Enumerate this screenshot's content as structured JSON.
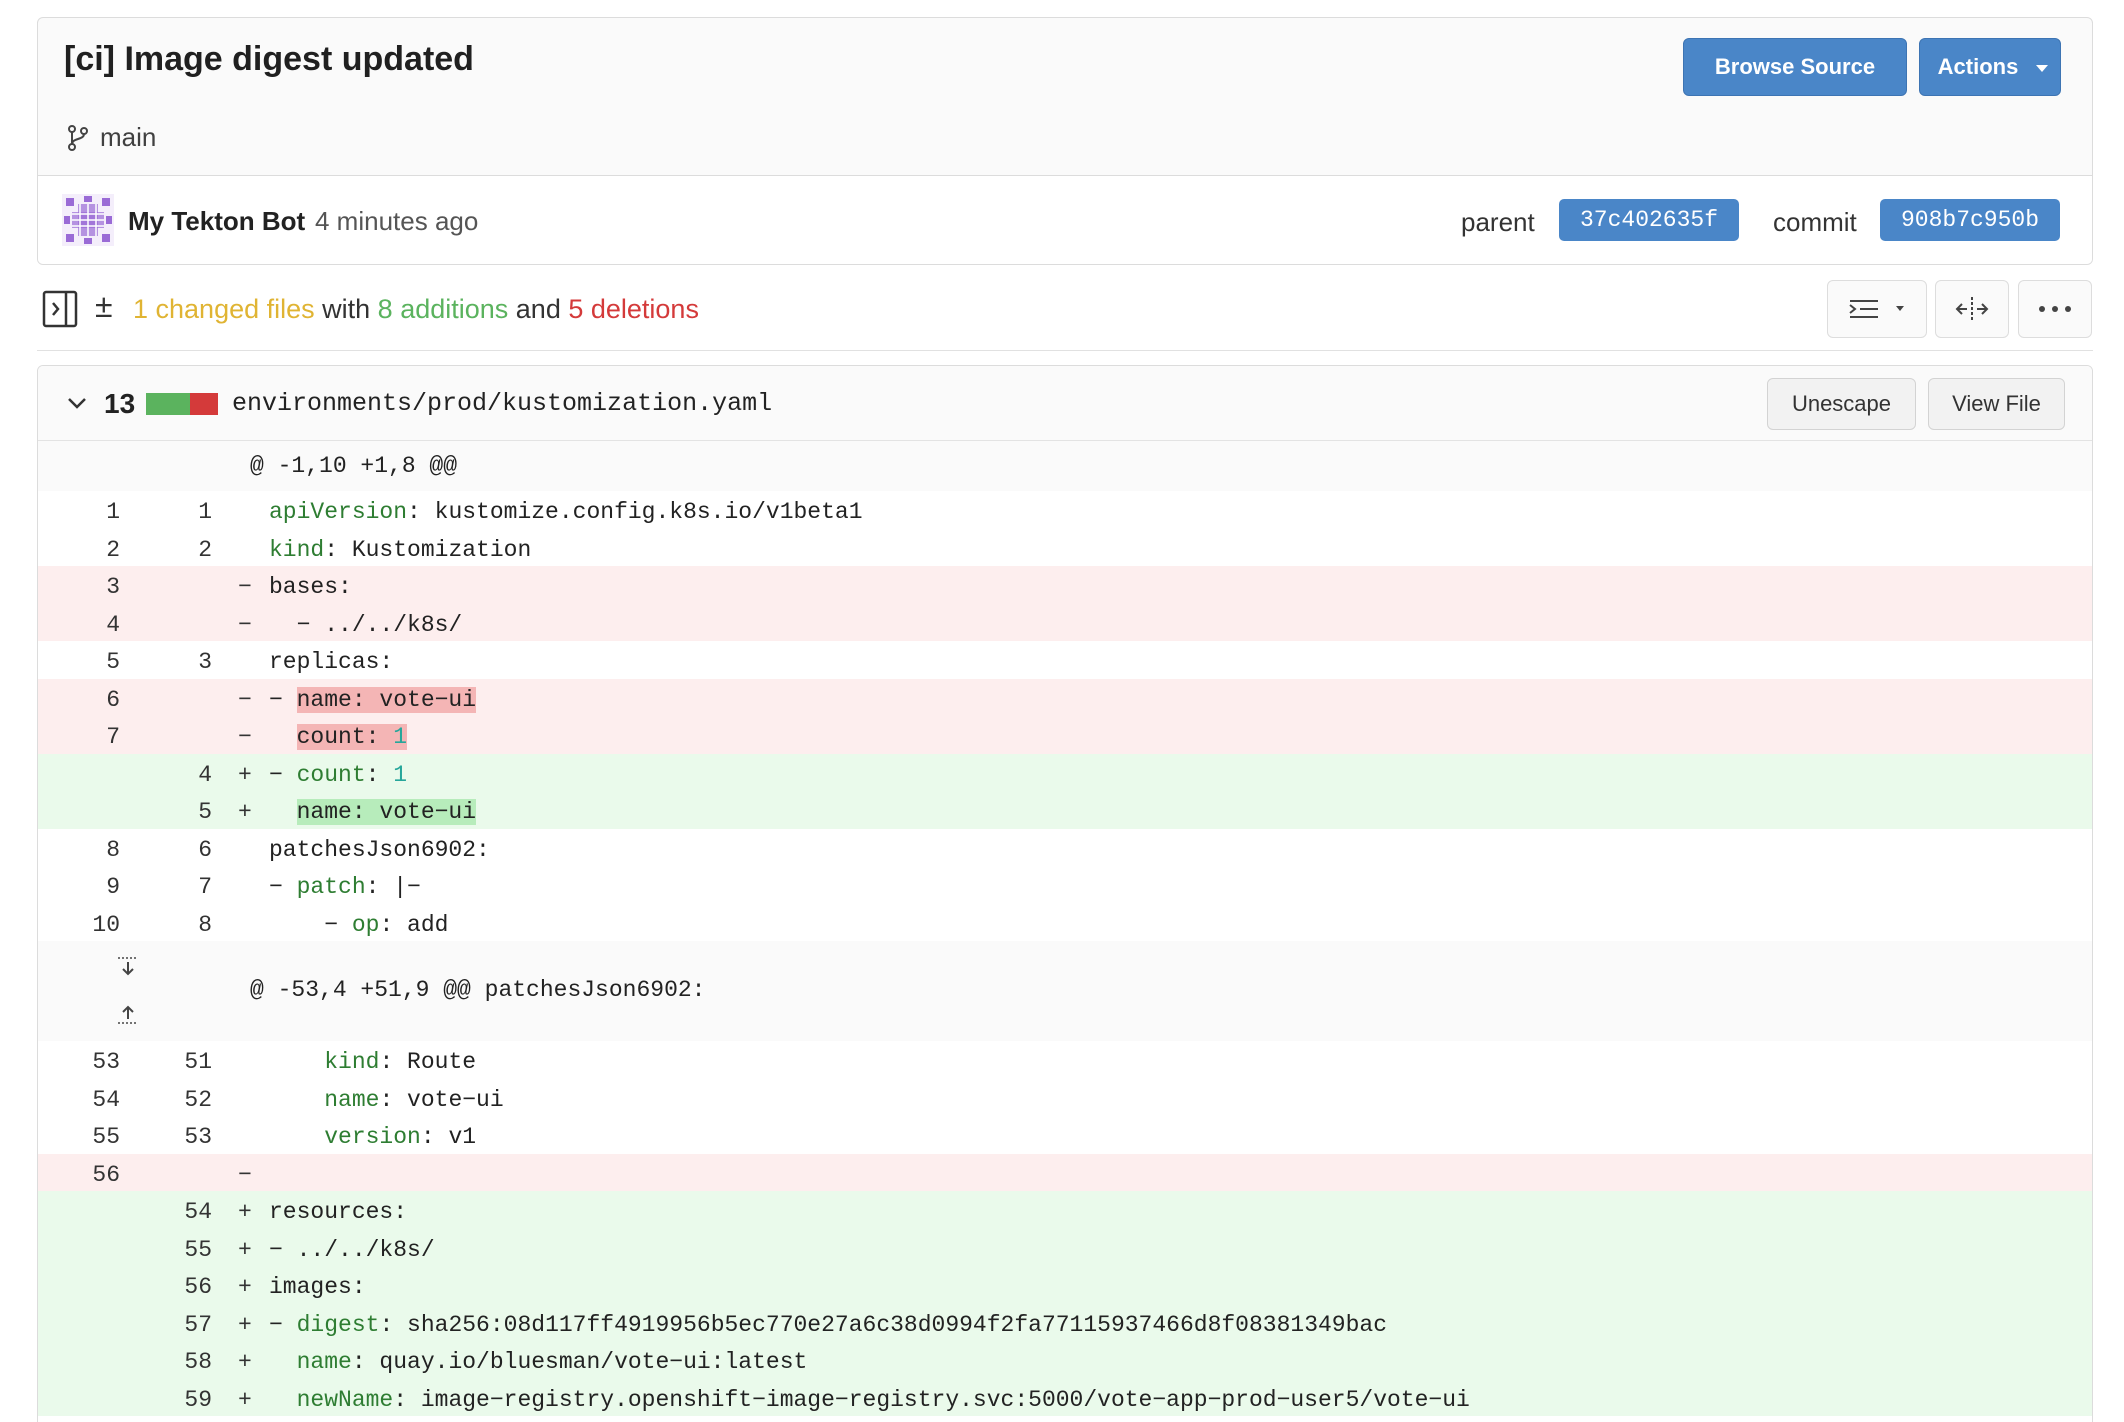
{
  "commit": {
    "title": "[ci] Image digest updated",
    "branch": "main",
    "author": "My Tekton Bot",
    "time": "4 minutes ago",
    "parent_label": "parent",
    "parent_hash": "37c402635f",
    "commit_label": "commit",
    "commit_hash": "908b7c950b"
  },
  "buttons": {
    "browse_source": "Browse Source",
    "actions": "Actions",
    "unescape": "Unescape",
    "view_file": "View File"
  },
  "summary": {
    "changed": "1 changed files",
    "with": " with ",
    "additions": "8 additions",
    "and": " and ",
    "deletions": "5 deletions"
  },
  "file": {
    "count": "13",
    "path": "environments/prod/kustomization.yaml"
  },
  "hunks": {
    "first": "@ -1,10 +1,8 @@",
    "second": "@ -53,4 +51,9 @@ patchesJson6902:"
  },
  "diff": [
    {
      "type": "ctx",
      "old": "1",
      "new": "1",
      "sign": "",
      "parts": [
        {
          "t": "apiVersion",
          "c": "k"
        },
        {
          "t": ": kustomize.config.k8s.io/v1beta1"
        }
      ]
    },
    {
      "type": "ctx",
      "old": "2",
      "new": "2",
      "sign": "",
      "parts": [
        {
          "t": "kind",
          "c": "k"
        },
        {
          "t": ": Kustomization"
        }
      ]
    },
    {
      "type": "del",
      "old": "3",
      "new": "",
      "sign": "−",
      "parts": [
        {
          "t": "bases:"
        }
      ]
    },
    {
      "type": "del",
      "old": "4",
      "new": "",
      "sign": "−",
      "parts": [
        {
          "t": "  − ../../k8s/"
        }
      ]
    },
    {
      "type": "ctx",
      "old": "5",
      "new": "3",
      "sign": "",
      "parts": [
        {
          "t": "replicas:"
        }
      ]
    },
    {
      "type": "del",
      "old": "6",
      "new": "",
      "sign": "−",
      "parts": [
        {
          "t": "− "
        },
        {
          "t": "name: vote−ui",
          "c": "hl-del"
        }
      ]
    },
    {
      "type": "del",
      "old": "7",
      "new": "",
      "sign": "−",
      "parts": [
        {
          "t": "  "
        },
        {
          "t": "count: ",
          "c": "hl-del"
        },
        {
          "t": "1",
          "c": "hl-del n"
        }
      ]
    },
    {
      "type": "add",
      "old": "",
      "new": "4",
      "sign": "+",
      "parts": [
        {
          "t": "− "
        },
        {
          "t": "count",
          "c": "k"
        },
        {
          "t": ": "
        },
        {
          "t": "1",
          "c": "n"
        }
      ]
    },
    {
      "type": "add",
      "old": "",
      "new": "5",
      "sign": "+",
      "parts": [
        {
          "t": "  "
        },
        {
          "t": "name: vote−ui",
          "c": "hl-add"
        }
      ]
    },
    {
      "type": "ctx",
      "old": "8",
      "new": "6",
      "sign": "",
      "parts": [
        {
          "t": "patchesJson6902:"
        }
      ]
    },
    {
      "type": "ctx",
      "old": "9",
      "new": "7",
      "sign": "",
      "parts": [
        {
          "t": "− "
        },
        {
          "t": "patch",
          "c": "k"
        },
        {
          "t": ": |−"
        }
      ]
    },
    {
      "type": "ctx",
      "old": "10",
      "new": "8",
      "sign": "",
      "parts": [
        {
          "t": "    − "
        },
        {
          "t": "op",
          "c": "k"
        },
        {
          "t": ": add"
        }
      ]
    }
  ],
  "diff2": [
    {
      "type": "ctx",
      "old": "53",
      "new": "51",
      "sign": "",
      "parts": [
        {
          "t": "    "
        },
        {
          "t": "kind",
          "c": "k"
        },
        {
          "t": ": Route"
        }
      ]
    },
    {
      "type": "ctx",
      "old": "54",
      "new": "52",
      "sign": "",
      "parts": [
        {
          "t": "    "
        },
        {
          "t": "name",
          "c": "k"
        },
        {
          "t": ": vote−ui"
        }
      ]
    },
    {
      "type": "ctx",
      "old": "55",
      "new": "53",
      "sign": "",
      "parts": [
        {
          "t": "    "
        },
        {
          "t": "version",
          "c": "k"
        },
        {
          "t": ": v1"
        }
      ]
    },
    {
      "type": "del",
      "old": "56",
      "new": "",
      "sign": "−",
      "parts": []
    },
    {
      "type": "add",
      "old": "",
      "new": "54",
      "sign": "+",
      "parts": [
        {
          "t": "resources:"
        }
      ]
    },
    {
      "type": "add",
      "old": "",
      "new": "55",
      "sign": "+",
      "parts": [
        {
          "t": "− ../../k8s/"
        }
      ]
    },
    {
      "type": "add",
      "old": "",
      "new": "56",
      "sign": "+",
      "parts": [
        {
          "t": "images:"
        }
      ]
    },
    {
      "type": "add",
      "old": "",
      "new": "57",
      "sign": "+",
      "parts": [
        {
          "t": "− "
        },
        {
          "t": "digest",
          "c": "k"
        },
        {
          "t": ": sha256:08d117ff4919956b5ec770e27a6c38d0994f2fa77115937466d8f08381349bac"
        }
      ]
    },
    {
      "type": "add",
      "old": "",
      "new": "58",
      "sign": "+",
      "parts": [
        {
          "t": "  "
        },
        {
          "t": "name",
          "c": "k"
        },
        {
          "t": ": quay.io/bluesman/vote−ui:latest"
        }
      ]
    },
    {
      "type": "add",
      "old": "",
      "new": "59",
      "sign": "+",
      "parts": [
        {
          "t": "  "
        },
        {
          "t": "newName",
          "c": "k"
        },
        {
          "t": ": image−registry.openshift−image−registry.svc:5000/vote−app−prod−user5/vote−ui"
        }
      ]
    }
  ],
  "icons": {
    "branch": "git-branch-icon",
    "sidebar": "sidebar-toggle-icon",
    "wrap": "wrap-lines-icon",
    "split": "split-view-icon",
    "more": "more-options-icon",
    "expand_down": "expand-down-icon",
    "expand_up": "expand-up-icon"
  },
  "colors": {
    "primary": "#4a86c8",
    "additions": "#5bb35e",
    "deletions": "#d43a3a",
    "changed": "#e0b433"
  }
}
